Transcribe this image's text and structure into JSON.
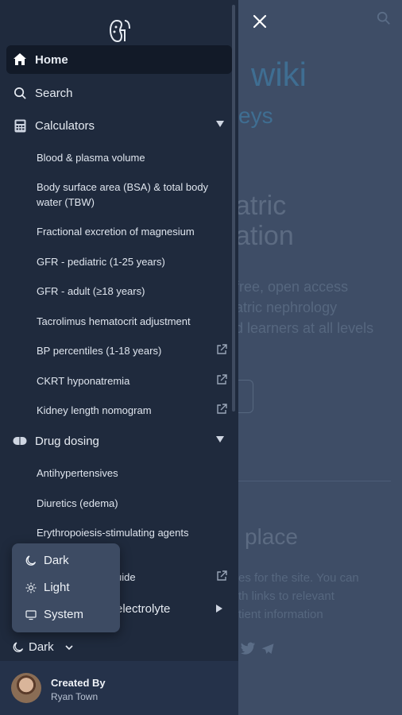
{
  "background": {
    "logo_text": "wiki",
    "logo_sub": "eys",
    "hero": [
      "atric",
      "ation"
    ],
    "desc": [
      "free, open access",
      "atric nephrology",
      "d learners at all levels"
    ],
    "place": "place",
    "desc2": [
      "es for the site. You can",
      "th links to relevant",
      "tient information"
    ]
  },
  "nav": {
    "home": "Home",
    "search": "Search",
    "calculators": "Calculators",
    "calculators_items": [
      "Blood & plasma volume",
      "Body surface area (BSA) & total body water (TBW)",
      "Fractional excretion of magnesium",
      "GFR - pediatric (1-25 years)",
      "GFR - adult (≥18 years)",
      "Tacrolimus hematocrit adjustment",
      "BP percentiles (1-18 years)",
      "CKRT hyponatremia",
      "Kidney length nomogram"
    ],
    "drug_dosing": "Drug dosing",
    "drug_items": [
      "Antihypertensives",
      "Diuretics (edema)",
      "Erythropoiesis-stimulating agents"
    ],
    "partial_guide": "uide",
    "partial_electrolyte": "electrolyte"
  },
  "theme": {
    "options": [
      "Dark",
      "Light",
      "System"
    ],
    "current": "Dark"
  },
  "footer": {
    "created_by": "Created By",
    "author": "Ryan Town"
  }
}
